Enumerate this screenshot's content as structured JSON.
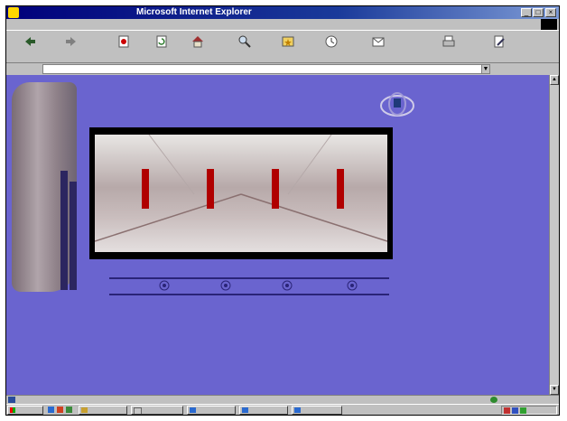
{
  "window": {
    "title_prefix": "",
    "title_app": "Microsoft Internet Explorer",
    "controls": [
      "_",
      "□",
      "×"
    ]
  },
  "menu": {
    "items": [
      "",
      "",
      "",
      "",
      "",
      ""
    ]
  },
  "toolbar": {
    "buttons": [
      {
        "label": "",
        "icon": "back-arrow-icon"
      },
      {
        "label": "",
        "icon": "forward-arrow-icon"
      },
      {
        "label": "",
        "icon": "stop-icon"
      },
      {
        "label": "",
        "icon": "refresh-icon"
      },
      {
        "label": "",
        "icon": "home-icon"
      },
      {
        "label": "",
        "icon": "search-icon"
      },
      {
        "label": "",
        "icon": "favorites-icon"
      },
      {
        "label": "",
        "icon": "history-icon"
      },
      {
        "label": "",
        "icon": "mail-icon"
      },
      {
        "label": "",
        "icon": "print-icon"
      },
      {
        "label": "",
        "icon": "edit-icon"
      }
    ]
  },
  "address": {
    "label": "",
    "url": "",
    "go_label": "",
    "links_label": ""
  },
  "page": {
    "banner_chars": [
      "",
      "",
      "",
      "",
      "",
      "",
      ""
    ],
    "stone_chars": [
      "",
      "",
      "",
      "",
      "",
      ""
    ],
    "nav_items": [
      "",
      "",
      "",
      ""
    ],
    "colors": {
      "background": "#6a64cf",
      "banner": "#1e5a1e",
      "accent": "#b00000"
    }
  },
  "status": {
    "text": "",
    "zone": ""
  },
  "taskbar": {
    "start_label": "",
    "tasks": [
      "",
      "",
      "",
      "",
      ""
    ],
    "clock": ""
  }
}
